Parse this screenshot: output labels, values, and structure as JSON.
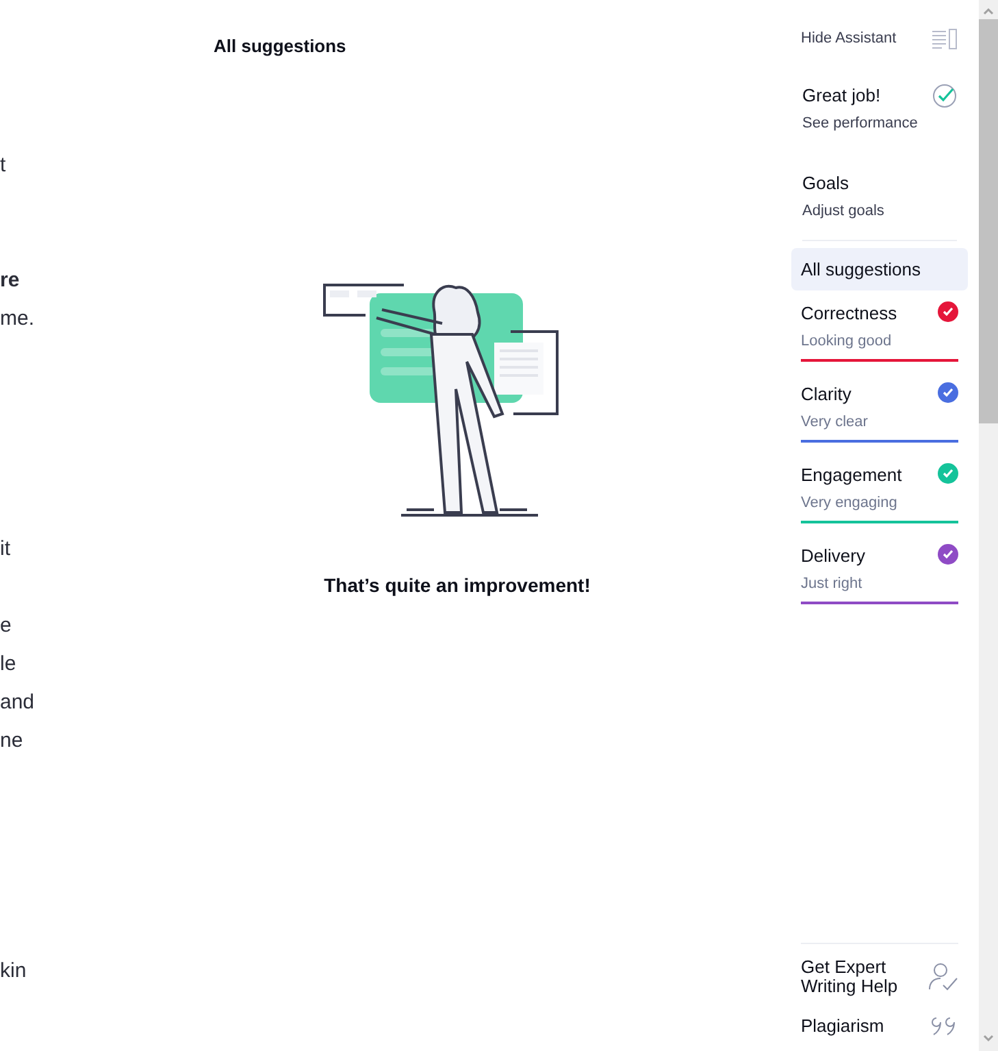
{
  "document_fragments": [
    {
      "text": "t",
      "bold": false
    },
    {
      "text": "re",
      "bold": true
    },
    {
      "text": "me.",
      "bold": false
    },
    {
      "text": "it",
      "bold": false
    },
    {
      "text": "e",
      "bold": false
    },
    {
      "text": "le",
      "bold": false
    },
    {
      "text": "and",
      "bold": false
    },
    {
      "text": "ne",
      "bold": false
    },
    {
      "text": "kin",
      "bold": false
    }
  ],
  "panel": {
    "title": "All suggestions",
    "message": "That’s quite an improvement!"
  },
  "assistant": {
    "hide_label": "Hide Assistant",
    "performance": {
      "title": "Great job!",
      "subtitle": "See performance"
    },
    "goals": {
      "title": "Goals",
      "subtitle": "Adjust goals"
    },
    "all_suggestions": {
      "label": "All suggestions",
      "selected": true
    },
    "categories": [
      {
        "name": "Correctness",
        "status": "Looking good",
        "color": "#e5163a",
        "selected": false
      },
      {
        "name": "Clarity",
        "status": "Very clear",
        "color": "#4a6ee0",
        "selected": false
      },
      {
        "name": "Engagement",
        "status": "Very engaging",
        "color": "#15c39a",
        "selected": false
      },
      {
        "name": "Delivery",
        "status": "Just right",
        "color": "#8f4bc5",
        "selected": false
      }
    ],
    "footer": [
      {
        "kind": "expert",
        "label": "Get Expert Writing Help"
      },
      {
        "kind": "plagiarism",
        "label": "Plagiarism"
      }
    ]
  }
}
